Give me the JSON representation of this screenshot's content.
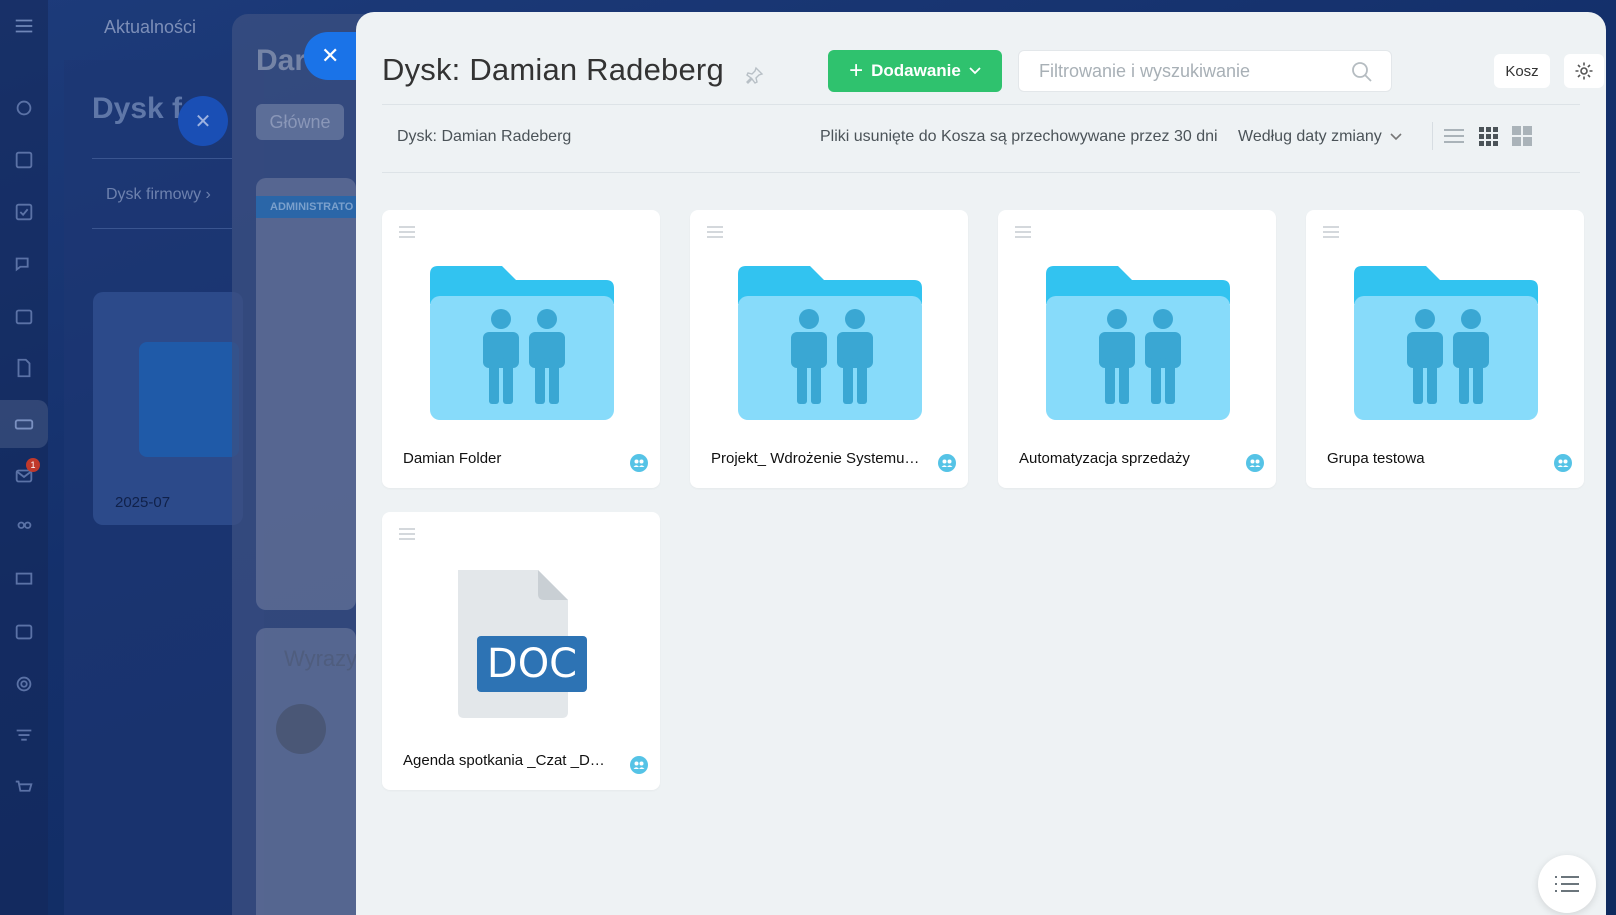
{
  "background": {
    "top_nav_label": "Aktualności",
    "panel1_title": "Dysk f",
    "panel1_breadcrumb": "Dysk firmowy",
    "panel1_card_label": "2025-07",
    "panel2_title": "Dar",
    "panel2_tab": "Główne",
    "panel2_admin": "ADMINISTRATO",
    "panel2_block_title": "Wyrazy",
    "notification_count": "1"
  },
  "header": {
    "title": "Dysk: Damian Radeberg",
    "add_label": "Dodawanie",
    "search_placeholder": "Filtrowanie i wyszukiwanie",
    "trash_label": "Kosz"
  },
  "toolbar": {
    "breadcrumb": "Dysk: Damian Radeberg",
    "info": "Pliki usunięte do Kosza są przechowywane przez 30 dni",
    "sort_label": "Według daty zmiany"
  },
  "items": [
    {
      "type": "folder",
      "name": "Damian Folder"
    },
    {
      "type": "folder",
      "name": "Projekt_ Wdrożenie Systemu C..."
    },
    {
      "type": "folder",
      "name": "Automatyzacja sprzedaży"
    },
    {
      "type": "folder",
      "name": "Grupa testowa"
    },
    {
      "type": "doc",
      "name": "Agenda spotkania _Czat _Doro...",
      "badge": "DOC"
    }
  ],
  "colors": {
    "add_button": "#2fc26e",
    "folder_tab": "#32c3f0",
    "folder_body": "#87dbfa",
    "folder_people": "#3aa7d3",
    "doc_badge": "#2d73b4"
  }
}
